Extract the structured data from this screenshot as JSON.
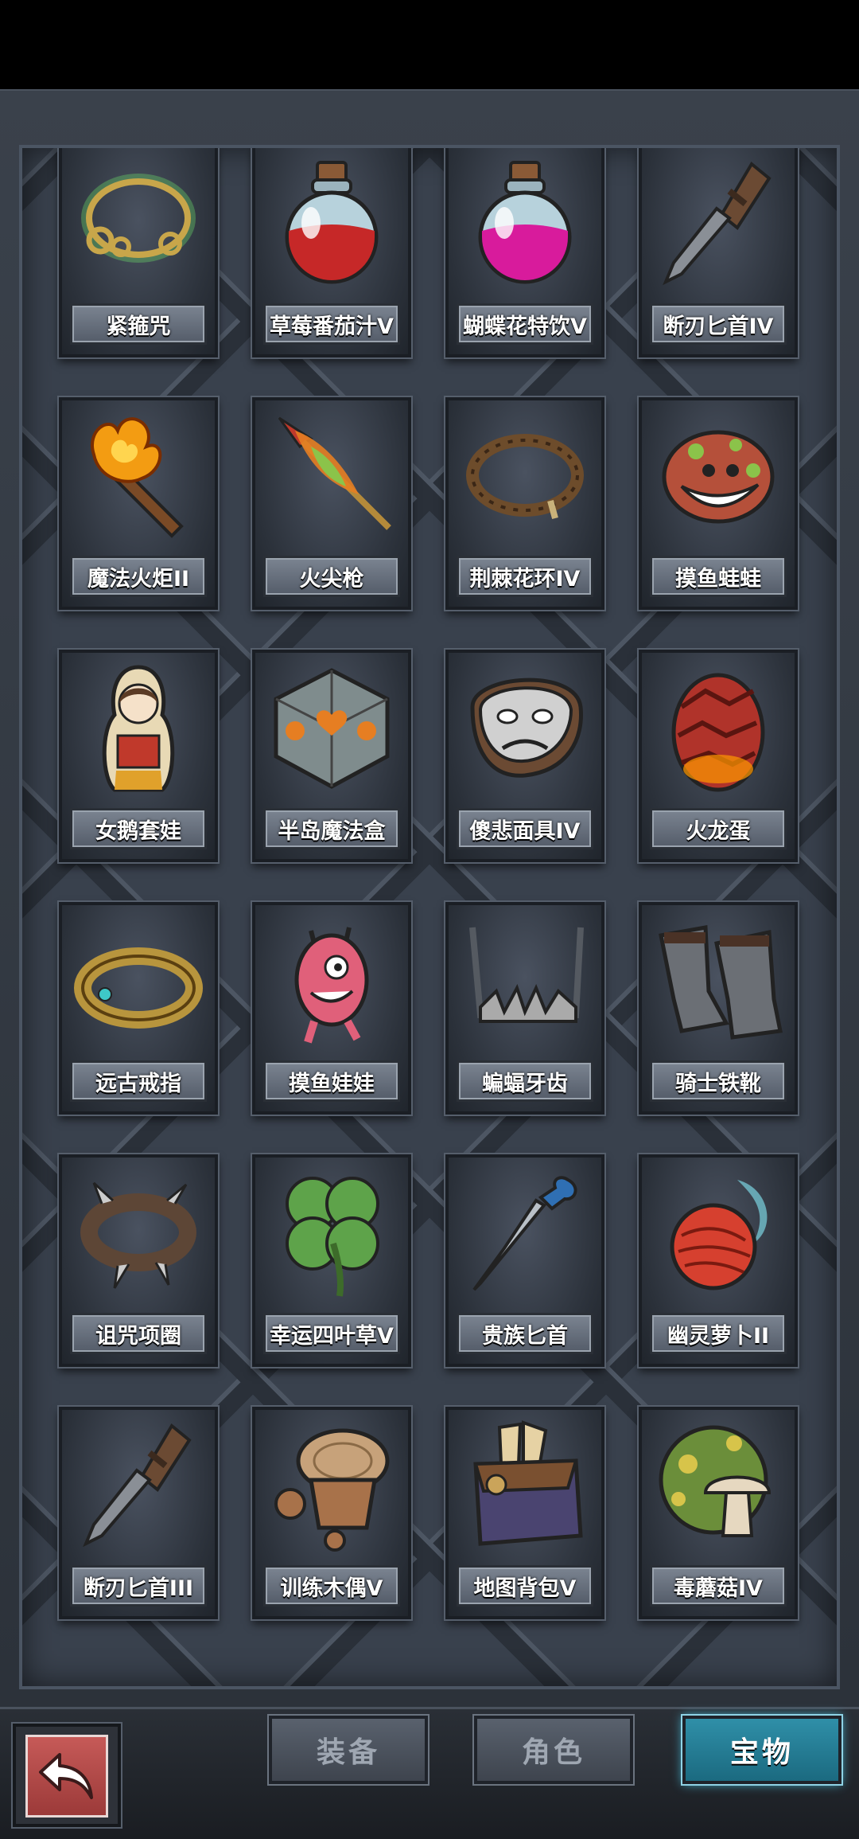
{
  "tabs": [
    {
      "label": "装备",
      "active": false
    },
    {
      "label": "角色",
      "active": false
    },
    {
      "label": "宝物",
      "active": true
    }
  ],
  "items": [
    {
      "name": "紧箍咒",
      "icon": "golden-headband-icon",
      "color": "#c8a64a"
    },
    {
      "name": "草莓番茄汁V",
      "icon": "red-potion-icon",
      "color": "#c62828"
    },
    {
      "name": "蝴蝶花特饮V",
      "icon": "pink-potion-icon",
      "color": "#d81b9c"
    },
    {
      "name": "断刃匕首IV",
      "icon": "broken-dagger-icon",
      "color": "#8a8f96"
    },
    {
      "name": "魔法火炬II",
      "icon": "magic-torch-icon",
      "color": "#f39c12"
    },
    {
      "name": "火尖枪",
      "icon": "fire-spear-icon",
      "color": "#e67e22"
    },
    {
      "name": "荆棘花环IV",
      "icon": "thorn-wreath-icon",
      "color": "#6d4c2b"
    },
    {
      "name": "摸鱼蛙蛙",
      "icon": "frog-creature-icon",
      "color": "#b5503a"
    },
    {
      "name": "女鹅套娃",
      "icon": "nesting-doll-icon",
      "color": "#c0392b"
    },
    {
      "name": "半岛魔法盒",
      "icon": "magic-cube-icon",
      "color": "#7f8c8d"
    },
    {
      "name": "傻悲面具IV",
      "icon": "sad-mask-icon",
      "color": "#d0d0d0"
    },
    {
      "name": "火龙蛋",
      "icon": "dragon-egg-icon",
      "color": "#b0332a"
    },
    {
      "name": "远古戒指",
      "icon": "ancient-ring-icon",
      "color": "#b8953d"
    },
    {
      "name": "摸鱼娃娃",
      "icon": "pink-doll-icon",
      "color": "#e0607a"
    },
    {
      "name": "蝙蝠牙齿",
      "icon": "bat-fangs-icon",
      "color": "#555a61"
    },
    {
      "name": "骑士铁靴",
      "icon": "knight-boots-icon",
      "color": "#6b6f75"
    },
    {
      "name": "诅咒项圈",
      "icon": "spiked-collar-icon",
      "color": "#5d4636"
    },
    {
      "name": "幸运四叶草V",
      "icon": "four-leaf-clover-icon",
      "color": "#5ea34a"
    },
    {
      "name": "贵族匕首",
      "icon": "noble-dagger-icon",
      "color": "#b9c0c7"
    },
    {
      "name": "幽灵萝卜II",
      "icon": "ghost-radish-icon",
      "color": "#d6402f"
    },
    {
      "name": "断刃匕首III",
      "icon": "broken-dagger-icon",
      "color": "#8a8f96"
    },
    {
      "name": "训练木偶V",
      "icon": "wooden-dummy-icon",
      "color": "#a8724a"
    },
    {
      "name": "地图背包V",
      "icon": "map-backpack-icon",
      "color": "#4a4470"
    },
    {
      "name": "毒蘑菇IV",
      "icon": "poison-mushroom-icon",
      "color": "#6b8e3a"
    }
  ]
}
